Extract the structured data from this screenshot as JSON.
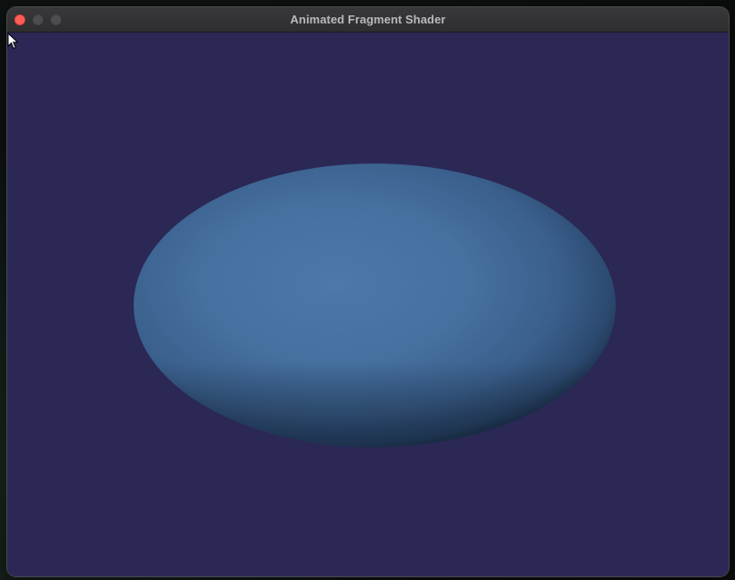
{
  "window": {
    "title": "Animated Fragment Shader"
  },
  "colors": {
    "canvas_background": "#2b2856",
    "shape_highlight": "#4e77aa",
    "shape_mid": "#3f6596",
    "shape_shadow": "#1e3450",
    "close_button": "#ff5f57"
  },
  "scene": {
    "shape": "shaded ellipse",
    "cursor": "arrow-pointer"
  }
}
